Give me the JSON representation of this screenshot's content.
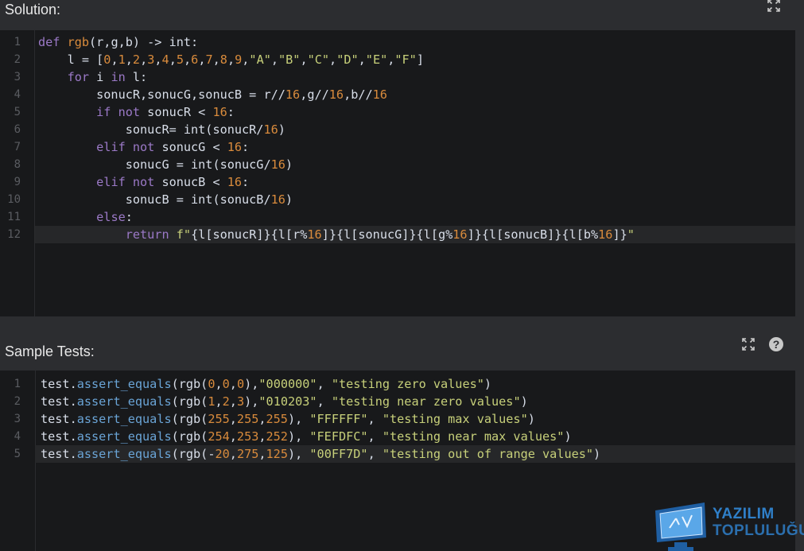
{
  "solution": {
    "title": "Solution:",
    "lines": [
      {
        "n": "1",
        "tokens": [
          [
            "kw",
            "def "
          ],
          [
            "fn",
            "rgb"
          ],
          [
            "plain",
            "(r,g,b) -> int:"
          ]
        ]
      },
      {
        "n": "2",
        "tokens": [
          [
            "plain",
            "    l = ["
          ],
          [
            "num",
            "0"
          ],
          [
            "plain",
            ","
          ],
          [
            "num",
            "1"
          ],
          [
            "plain",
            ","
          ],
          [
            "num",
            "2"
          ],
          [
            "plain",
            ","
          ],
          [
            "num",
            "3"
          ],
          [
            "plain",
            ","
          ],
          [
            "num",
            "4"
          ],
          [
            "plain",
            ","
          ],
          [
            "num",
            "5"
          ],
          [
            "plain",
            ","
          ],
          [
            "num",
            "6"
          ],
          [
            "plain",
            ","
          ],
          [
            "num",
            "7"
          ],
          [
            "plain",
            ","
          ],
          [
            "num",
            "8"
          ],
          [
            "plain",
            ","
          ],
          [
            "num",
            "9"
          ],
          [
            "plain",
            ","
          ],
          [
            "str",
            "\"A\""
          ],
          [
            "plain",
            ","
          ],
          [
            "str",
            "\"B\""
          ],
          [
            "plain",
            ","
          ],
          [
            "str",
            "\"C\""
          ],
          [
            "plain",
            ","
          ],
          [
            "str",
            "\"D\""
          ],
          [
            "plain",
            ","
          ],
          [
            "str",
            "\"E\""
          ],
          [
            "plain",
            ","
          ],
          [
            "str",
            "\"F\""
          ],
          [
            "plain",
            "]"
          ]
        ]
      },
      {
        "n": "3",
        "tokens": [
          [
            "plain",
            "    "
          ],
          [
            "kw",
            "for"
          ],
          [
            "plain",
            " i "
          ],
          [
            "kw",
            "in"
          ],
          [
            "plain",
            " l:"
          ]
        ]
      },
      {
        "n": "4",
        "tokens": [
          [
            "plain",
            "        sonucR,sonucG,sonucB = r//"
          ],
          [
            "num",
            "16"
          ],
          [
            "plain",
            ",g//"
          ],
          [
            "num",
            "16"
          ],
          [
            "plain",
            ",b//"
          ],
          [
            "num",
            "16"
          ]
        ]
      },
      {
        "n": "5",
        "tokens": [
          [
            "plain",
            "        "
          ],
          [
            "kw",
            "if not"
          ],
          [
            "plain",
            " sonucR < "
          ],
          [
            "num",
            "16"
          ],
          [
            "plain",
            ":"
          ]
        ]
      },
      {
        "n": "6",
        "tokens": [
          [
            "plain",
            "            sonucR= int(sonucR/"
          ],
          [
            "num",
            "16"
          ],
          [
            "plain",
            ")"
          ]
        ]
      },
      {
        "n": "7",
        "tokens": [
          [
            "plain",
            "        "
          ],
          [
            "kw",
            "elif not"
          ],
          [
            "plain",
            " sonucG < "
          ],
          [
            "num",
            "16"
          ],
          [
            "plain",
            ":"
          ]
        ]
      },
      {
        "n": "8",
        "tokens": [
          [
            "plain",
            "            sonucG = int(sonucG/"
          ],
          [
            "num",
            "16"
          ],
          [
            "plain",
            ")"
          ]
        ]
      },
      {
        "n": "9",
        "tokens": [
          [
            "plain",
            "        "
          ],
          [
            "kw",
            "elif not"
          ],
          [
            "plain",
            " sonucB < "
          ],
          [
            "num",
            "16"
          ],
          [
            "plain",
            ":"
          ]
        ]
      },
      {
        "n": "10",
        "tokens": [
          [
            "plain",
            "            sonucB = int(sonucB/"
          ],
          [
            "num",
            "16"
          ],
          [
            "plain",
            ")"
          ]
        ]
      },
      {
        "n": "11",
        "tokens": [
          [
            "plain",
            "        "
          ],
          [
            "kw",
            "else"
          ],
          [
            "plain",
            ":"
          ]
        ]
      },
      {
        "n": "12",
        "tokens": [
          [
            "plain",
            "            "
          ],
          [
            "kw",
            "return"
          ],
          [
            "plain",
            " "
          ],
          [
            "str",
            "f\""
          ],
          [
            "plain",
            "{l[sonucR]}{l[r%"
          ],
          [
            "num",
            "16"
          ],
          [
            "plain",
            "]}{l[sonucG]}{l[g%"
          ],
          [
            "num",
            "16"
          ],
          [
            "plain",
            "]}{l[sonucB]}{l[b%"
          ],
          [
            "num",
            "16"
          ],
          [
            "plain",
            "]}"
          ],
          [
            "str",
            "\""
          ]
        ]
      }
    ],
    "active_line": 12
  },
  "sample_tests": {
    "title": "Sample Tests:",
    "lines": [
      {
        "n": "1",
        "tokens": [
          [
            "plain",
            "test"
          ],
          [
            "plain",
            "."
          ],
          [
            "meth",
            "assert_equals"
          ],
          [
            "plain",
            "(rgb("
          ],
          [
            "num",
            "0"
          ],
          [
            "plain",
            ","
          ],
          [
            "num",
            "0"
          ],
          [
            "plain",
            ","
          ],
          [
            "num",
            "0"
          ],
          [
            "plain",
            "),"
          ],
          [
            "str",
            "\"000000\""
          ],
          [
            "plain",
            ", "
          ],
          [
            "str",
            "\"testing zero values\""
          ],
          [
            "plain",
            ")"
          ]
        ]
      },
      {
        "n": "2",
        "tokens": [
          [
            "plain",
            "test"
          ],
          [
            "plain",
            "."
          ],
          [
            "meth",
            "assert_equals"
          ],
          [
            "plain",
            "(rgb("
          ],
          [
            "num",
            "1"
          ],
          [
            "plain",
            ","
          ],
          [
            "num",
            "2"
          ],
          [
            "plain",
            ","
          ],
          [
            "num",
            "3"
          ],
          [
            "plain",
            "),"
          ],
          [
            "str",
            "\"010203\""
          ],
          [
            "plain",
            ", "
          ],
          [
            "str",
            "\"testing near zero values\""
          ],
          [
            "plain",
            ")"
          ]
        ]
      },
      {
        "n": "3",
        "tokens": [
          [
            "plain",
            "test"
          ],
          [
            "plain",
            "."
          ],
          [
            "meth",
            "assert_equals"
          ],
          [
            "plain",
            "(rgb("
          ],
          [
            "num",
            "255"
          ],
          [
            "plain",
            ","
          ],
          [
            "num",
            "255"
          ],
          [
            "plain",
            ","
          ],
          [
            "num",
            "255"
          ],
          [
            "plain",
            "), "
          ],
          [
            "str",
            "\"FFFFFF\""
          ],
          [
            "plain",
            ", "
          ],
          [
            "str",
            "\"testing max values\""
          ],
          [
            "plain",
            ")"
          ]
        ]
      },
      {
        "n": "4",
        "tokens": [
          [
            "plain",
            "test"
          ],
          [
            "plain",
            "."
          ],
          [
            "meth",
            "assert_equals"
          ],
          [
            "plain",
            "(rgb("
          ],
          [
            "num",
            "254"
          ],
          [
            "plain",
            ","
          ],
          [
            "num",
            "253"
          ],
          [
            "plain",
            ","
          ],
          [
            "num",
            "252"
          ],
          [
            "plain",
            "), "
          ],
          [
            "str",
            "\"FEFDFC\""
          ],
          [
            "plain",
            ", "
          ],
          [
            "str",
            "\"testing near max values\""
          ],
          [
            "plain",
            ")"
          ]
        ]
      },
      {
        "n": "5",
        "tokens": [
          [
            "plain",
            "test"
          ],
          [
            "plain",
            "."
          ],
          [
            "meth",
            "assert_equals"
          ],
          [
            "plain",
            "(rgb(-"
          ],
          [
            "num",
            "20"
          ],
          [
            "plain",
            ","
          ],
          [
            "num",
            "275"
          ],
          [
            "plain",
            ","
          ],
          [
            "num",
            "125"
          ],
          [
            "plain",
            "), "
          ],
          [
            "str",
            "\"00FF7D\""
          ],
          [
            "plain",
            ", "
          ],
          [
            "str",
            "\"testing out of range values\""
          ],
          [
            "plain",
            ")"
          ]
        ]
      }
    ],
    "active_line": 5
  },
  "icons": {
    "expand": "expand-icon",
    "help": "help-icon"
  },
  "help_glyph": "?",
  "logo": {
    "line1": "YAZILIM",
    "line2": "TOPLULUĞU"
  },
  "colors": {
    "keyword": "#9b79c7",
    "number": "#d98b3c",
    "string": "#c7d07a",
    "method": "#6aa4d6",
    "brand": "#2f7fc8"
  }
}
